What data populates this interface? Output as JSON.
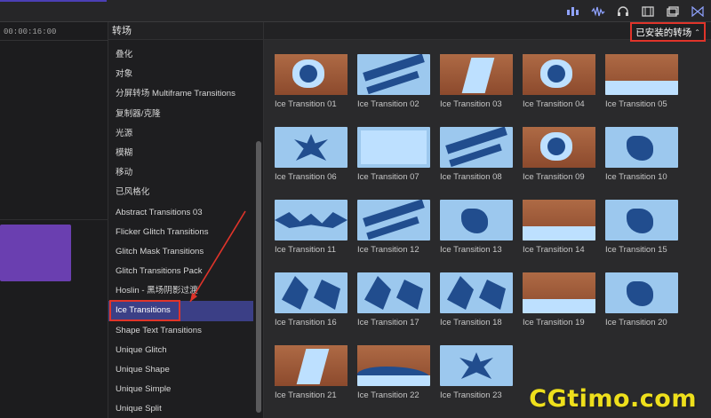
{
  "timeline": {
    "timecode": "00:00:16:00"
  },
  "sidebar": {
    "title": "转场",
    "categories": [
      "叠化",
      "对象",
      "分屏转场 Multiframe Transitions",
      "复制器/克隆",
      "光源",
      "模糊",
      "移动",
      "已风格化",
      "Abstract Transitions 03",
      "Flicker Glitch Transitions",
      "Glitch Mask Transitions",
      "Glitch Transitions Pack",
      "Hoslin - 黑场阴影过渡",
      "Ice Transitions",
      "Shape Text Transitions",
      "Unique Glitch",
      "Unique Shape",
      "Unique Simple",
      "Unique Split"
    ],
    "selected": "Ice Transitions"
  },
  "browser": {
    "dropdown_label": "已安装的转场",
    "tiles": [
      "Ice Transition 01",
      "Ice Transition 02",
      "Ice Transition 03",
      "Ice Transition 04",
      "Ice Transition 05",
      "Ice Transition 06",
      "Ice Transition 07",
      "Ice Transition 08",
      "Ice Transition 09",
      "Ice Transition 10",
      "Ice Transition 11",
      "Ice Transition 12",
      "Ice Transition 13",
      "Ice Transition 14",
      "Ice Transition 15",
      "Ice Transition 16",
      "Ice Transition 17",
      "Ice Transition 18",
      "Ice Transition 19",
      "Ice Transition 20",
      "Ice Transition 21",
      "Ice Transition 22",
      "Ice Transition 23"
    ]
  },
  "watermark": "CGtimo.com",
  "colors": {
    "accent": "#4b3fb5",
    "selection": "#3b3f86",
    "highlight": "#e0342a",
    "watermark": "#eedf1c"
  },
  "icons": [
    "audio-meter-icon",
    "waveform-icon",
    "headphones-icon",
    "filmstrip-icon",
    "window-icon",
    "bowtie-icon",
    "chevron-updown-icon"
  ]
}
